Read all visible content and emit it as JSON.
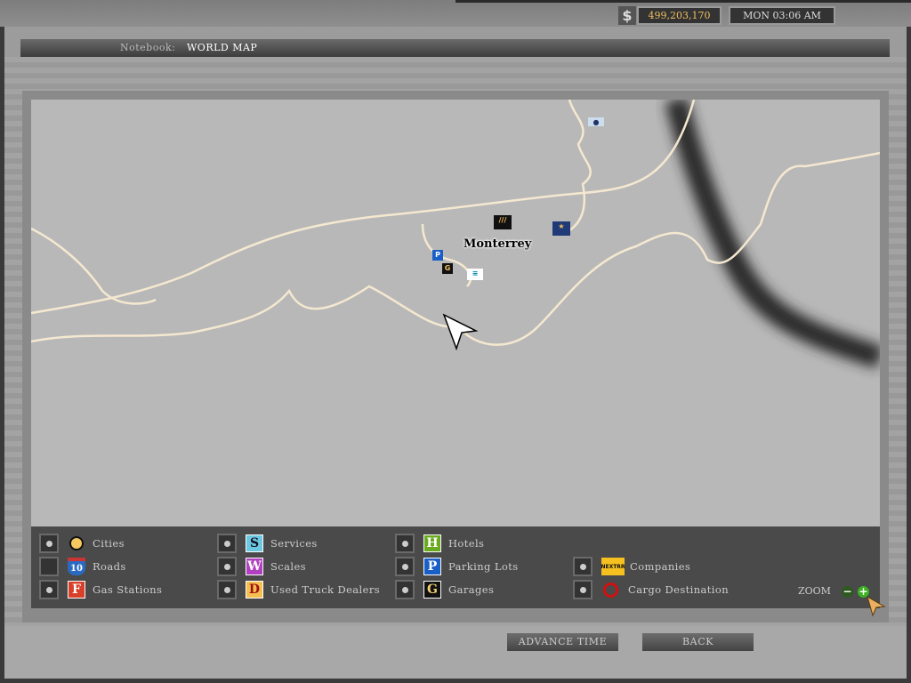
{
  "header": {
    "currency_symbol": "$",
    "money": "499,203,170",
    "datetime": "MON 03:06 AM"
  },
  "notebook": {
    "label": "Notebook:",
    "title": "WORLD MAP"
  },
  "map": {
    "city_label": "Monterrey",
    "poi": {
      "parking": "P",
      "garage": "G"
    }
  },
  "legend": {
    "items": [
      {
        "label": "Cities",
        "checked": true
      },
      {
        "label": "Roads",
        "checked": false,
        "icon_text": "10"
      },
      {
        "label": "Gas Stations",
        "checked": true,
        "icon_text": "F"
      },
      {
        "label": "Services",
        "checked": true,
        "icon_text": "S"
      },
      {
        "label": "Scales",
        "checked": true,
        "icon_text": "W"
      },
      {
        "label": "Used Truck Dealers",
        "checked": true,
        "icon_text": "D"
      },
      {
        "label": "Hotels",
        "checked": true,
        "icon_text": "H"
      },
      {
        "label": "Parking Lots",
        "checked": true,
        "icon_text": "P"
      },
      {
        "label": "Garages",
        "checked": true,
        "icon_text": "G"
      },
      {
        "label": "Companies",
        "checked": true,
        "icon_text": "NEXTRR"
      },
      {
        "label": "Cargo Destination",
        "checked": true
      }
    ],
    "zoom_label": "ZOOM",
    "zoom_out": "−",
    "zoom_in": "+"
  },
  "buttons": {
    "advance_time": "ADVANCE TIME",
    "back": "BACK"
  },
  "colors": {
    "road": "#f5e8d0",
    "money": "#f0c060",
    "highway": "#2a2a2a"
  }
}
